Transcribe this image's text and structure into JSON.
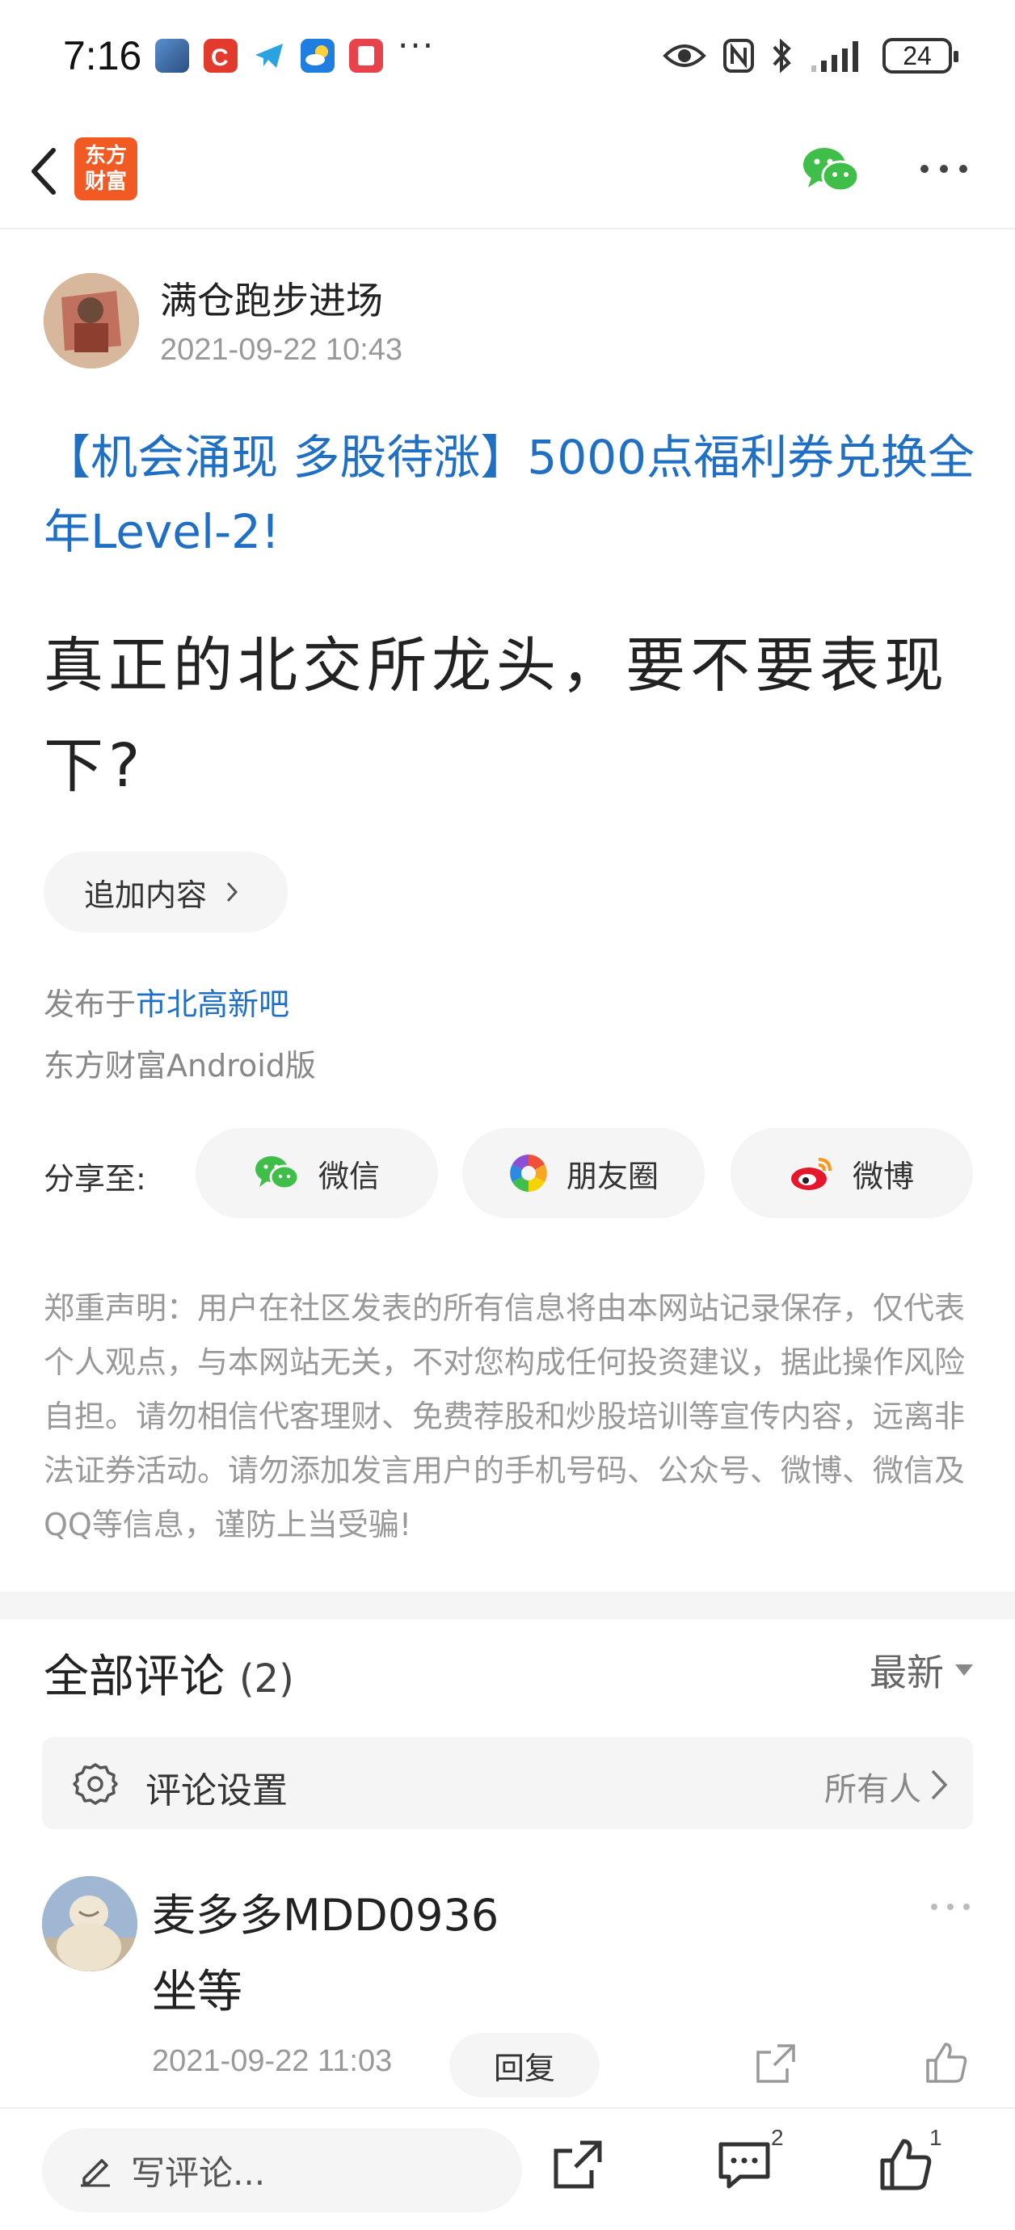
{
  "status_bar": {
    "time": "7:16",
    "app_icons": [
      {
        "name": "game-app-icon",
        "color": "#3c6fa8"
      },
      {
        "name": "c-app-icon",
        "color": "#e23a2c"
      },
      {
        "name": "telegram-app-icon",
        "color": "#2aa3e0"
      },
      {
        "name": "weather-app-icon",
        "color": "#1f7ee0"
      },
      {
        "name": "reader-app-icon",
        "color": "#e8424b"
      }
    ],
    "more": "···",
    "battery": "24"
  },
  "nav": {
    "logo_text_line1": "东方",
    "logo_text_line2": "财富",
    "brand_color": "#f15a22"
  },
  "post": {
    "author": "满仓跑步进场",
    "time": "2021-09-22 10:43",
    "promo": "【机会涌现 多股待涨】5000点福利券兑换全年Level-2!",
    "title": "真正的北交所龙头，要不要表现下?",
    "append_label": "追加内容",
    "posted_in_prefix": "发布于",
    "posted_in_forum": "市北高新吧",
    "platform": "东方财富Android版"
  },
  "share": {
    "label": "分享至:",
    "buttons": [
      {
        "label": "微信"
      },
      {
        "label": "朋友圈"
      },
      {
        "label": "微博"
      }
    ]
  },
  "disclaimer": "郑重声明：用户在社区发表的所有信息将由本网站记录保存，仅代表个人观点，与本网站无关，不对您构成任何投资建议，据此操作风险自担。请勿相信代客理财、免费荐股和炒股培训等宣传内容，远离非法证券活动。请勿添加发言用户的手机号码、公众号、微博、微信及QQ等信息，谨防上当受骗!",
  "comments": {
    "title": "全部评论",
    "count": "(2)",
    "sort_label": "最新",
    "settings_label": "评论设置",
    "settings_value": "所有人",
    "items": [
      {
        "author": "麦多多MDD0936",
        "text": "坐等",
        "time": "2021-09-22 11:03",
        "reply_label": "回复"
      }
    ]
  },
  "bottom_bar": {
    "write_placeholder": "写评论...",
    "comment_count": "2",
    "like_count": "1"
  }
}
